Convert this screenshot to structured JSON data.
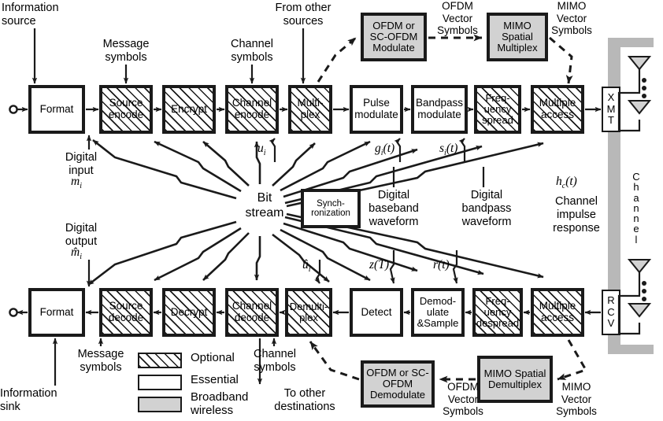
{
  "title": "Digital communication system block diagram",
  "legend": {
    "items": [
      {
        "label": "Optional",
        "style": "hatched"
      },
      {
        "label": "Essential",
        "style": "white"
      },
      {
        "label": "Broadband\nwireless",
        "style": "gray"
      }
    ]
  },
  "transmit_chain": {
    "blocks": [
      {
        "label": "Format",
        "style": "essential"
      },
      {
        "label": "Source\nencode",
        "style": "optional"
      },
      {
        "label": "Encrypt",
        "style": "optional"
      },
      {
        "label": "Channel\nencode",
        "style": "optional"
      },
      {
        "label": "Multi-\nplex",
        "style": "optional"
      },
      {
        "label": "Pulse\nmodulate",
        "style": "essential"
      },
      {
        "label": "Bandpass\nmodulate",
        "style": "essential"
      },
      {
        "label": "Freq-\nuency\nspread",
        "style": "optional"
      },
      {
        "label": "Multiple\naccess",
        "style": "optional"
      }
    ],
    "terminal": "X\nM\nT"
  },
  "receive_chain": {
    "blocks": [
      {
        "label": "Format",
        "style": "essential"
      },
      {
        "label": "Source\ndecode",
        "style": "optional"
      },
      {
        "label": "Decrypt",
        "style": "optional"
      },
      {
        "label": "Channel\ndecode",
        "style": "optional"
      },
      {
        "label": "Demulti-\nplex",
        "style": "optional"
      },
      {
        "label": "Detect",
        "style": "essential"
      },
      {
        "label": "Demod-\nulate\n&Sample",
        "style": "essential"
      },
      {
        "label": "Freq-\nuency\ndespread",
        "style": "optional"
      },
      {
        "label": "Multiple\naccess",
        "style": "optional"
      }
    ],
    "terminal": "R\nC\nV"
  },
  "broadband": {
    "ofdm_modulate": "OFDM  or\nSC-OFDM\nModulate",
    "mimo_multiplex": "MIMO\nSpatial\nMultiplex",
    "ofdm_demodulate": "OFDM  or\nSC-OFDM\nDemodulate",
    "mimo_demultiplex": "MIMO\nSpatial\nDemultiplex",
    "ofdm_vector_symbols_top": "OFDM\nVector\nSymbols",
    "mimo_vector_symbols_top": "MIMO\nVector\nSymbols",
    "ofdm_vector_symbols_bottom": "OFDM\nVector\nSymbols",
    "mimo_vector_symbols_bottom": "MIMO\nVector\nSymbols"
  },
  "center": {
    "bit_stream": "Bit\nstream",
    "synchronization": "Synch-\nronization"
  },
  "annotations": {
    "information_source": "Information\nsource",
    "information_sink": "Information\nsink",
    "message_symbols_top": "Message\nsymbols",
    "message_symbols_bottom": "Message\nsymbols",
    "channel_symbols_top": "Channel\nsymbols",
    "channel_symbols_bottom": "Channel\nsymbols",
    "from_other_sources": "From other\nsources",
    "to_other_destinations": "To other\ndestinations",
    "digital_input": "Digital\ninput",
    "digital_output": "Digital\noutput",
    "digital_baseband_waveform": "Digital\nbaseband\nwaveform",
    "digital_bandpass_waveform": "Digital\nbandpass\nwaveform",
    "channel_impulse_response": "Channel\nimpulse\nresponse",
    "channel_label": "Channel"
  },
  "signals": {
    "m_i": "m",
    "m_i_sub": "i",
    "u_i": "u",
    "u_i_sub": "i",
    "g_i_t": "g",
    "g_i_sub": "i",
    "g_i_arg": "(t)",
    "s_i_t": "s",
    "s_i_sub": "i",
    "s_i_arg": "(t)",
    "h_c_t": "h",
    "h_c_sub": "c",
    "h_c_arg": "(t)",
    "m_hat_i": "m̂",
    "u_hat_i": "û",
    "z_T": "z(T)",
    "r_t": "r(t)"
  },
  "colors": {
    "stroke": "#1a1a1a",
    "broadband_fill": "#d2d2d2",
    "channel_frame": "#b8b8b8",
    "background": "#ffffff"
  }
}
